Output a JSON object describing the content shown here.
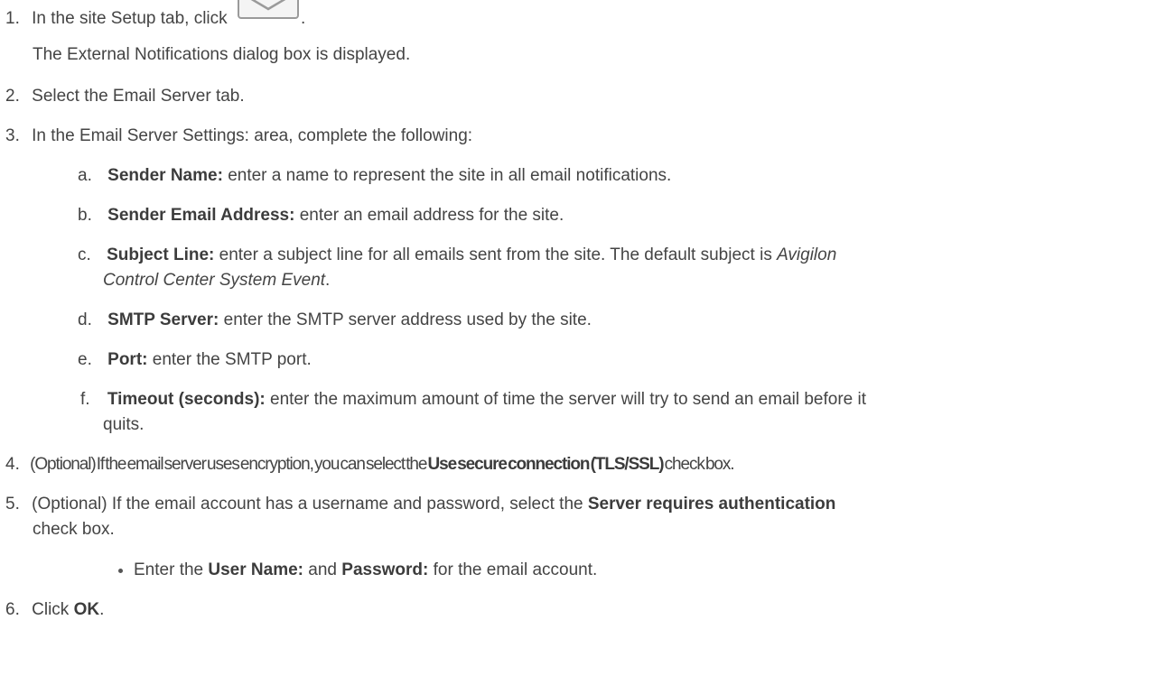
{
  "step1": {
    "num": "1.",
    "text": "In the site Setup tab, click",
    "after_icon": ".",
    "icon": "envelope-icon"
  },
  "step1_result": "The External Notifications dialog box is displayed.",
  "step2": {
    "num": "2.",
    "text": "Select the Email Server tab."
  },
  "step3": {
    "num": "3.",
    "text": "In the Email Server Settings: area, complete the following:"
  },
  "sub": [
    {
      "letter": "a.",
      "label": "Sender Name:",
      "text": " enter a name to represent the site in all email notifications."
    },
    {
      "letter": "b.",
      "label": "Sender Email Address:",
      "text": " enter an email address for the site."
    },
    {
      "letter": "c.",
      "label": "Subject Line:",
      "text": " enter a subject line for all emails sent from the site. The default subject is ",
      "italic1": "Avigilon",
      "line2_italic": "Control Center System Event",
      "line2_rest": "."
    },
    {
      "letter": "d.",
      "label": "SMTP Server:",
      "text": " enter the SMTP server address used by the site."
    },
    {
      "letter": "e.",
      "label": "Port:",
      "text": " enter the SMTP port."
    },
    {
      "letter": "f.",
      "label": "Timeout (seconds):",
      "text": " enter the maximum amount of time the server will try to send an email before it",
      "line2": "quits."
    }
  ],
  "step4": {
    "num": "4.",
    "pre": "(Optional) If the email server uses encryption, you can select the ",
    "bold": "Use secure connection (TLS/SSL)",
    "post": " check box."
  },
  "step5": {
    "num": "5.",
    "pre": "(Optional) If the email account has a username and password, select the ",
    "bold": "Server requires authentication",
    "line2": "check box."
  },
  "bullet": {
    "pre": "Enter the ",
    "bold1": "User Name:",
    "mid": " and ",
    "bold2": "Password:",
    "post": " for the email account."
  },
  "step6": {
    "num": "6.",
    "pre": "Click ",
    "bold": "OK",
    "post": "."
  }
}
